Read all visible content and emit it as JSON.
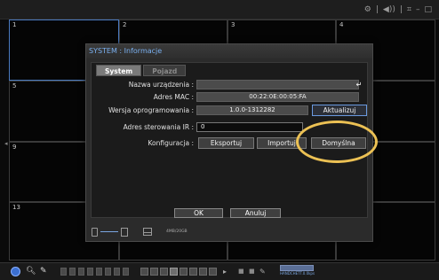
{
  "topbar": {
    "icons": [
      "⚙",
      "|",
      "◀))",
      "|",
      "⌗",
      "–",
      "□"
    ]
  },
  "grid": {
    "cell_numbers": [
      "1",
      "2",
      "3",
      "4",
      "5",
      "9",
      "13"
    ]
  },
  "dialog": {
    "title": "SYSTEM : Informacje",
    "tabs": [
      {
        "label": "System",
        "active": true
      },
      {
        "label": "Pojazd",
        "active": false
      }
    ],
    "fields": {
      "device_name": {
        "label": "Nazwa urządzenia :",
        "value": ""
      },
      "mac": {
        "label": "Adres MAC :",
        "value": "00:22:0E:00:05:FA"
      },
      "firmware": {
        "label": "Wersja oprogramowania :",
        "value": "1.0.0-1312282",
        "button": "Aktualizuj"
      },
      "ir": {
        "label": "Adres sterowania IR :",
        "value": "0"
      },
      "config": {
        "label": "Konfiguracja :",
        "export": "Eksportuj",
        "import": "Importuj",
        "default": "Domyślna"
      }
    },
    "ok": "OK",
    "cancel": "Anuluj",
    "storage_text": "4MB/20GB"
  },
  "bottombar": {
    "status_text": "HANDCHETT.0.0kps"
  },
  "highlight_color": "#ecc154",
  "accent_color": "#7ab0f0"
}
